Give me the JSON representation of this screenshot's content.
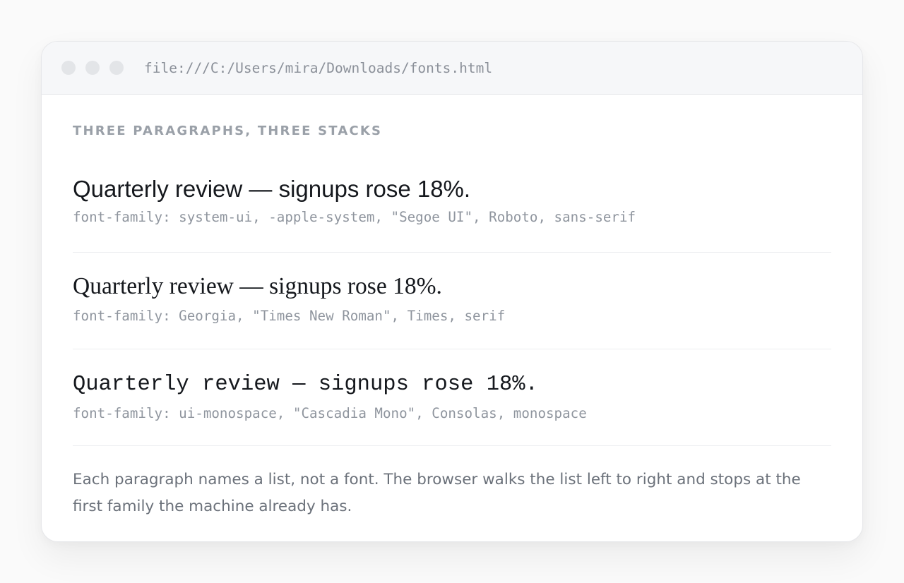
{
  "window": {
    "address": "file:///C:/Users/mira/Downloads/fonts.html",
    "controls": [
      "close-icon",
      "minimize-icon",
      "maximize-icon"
    ]
  },
  "page": {
    "heading": "THREE PARAGRAPHS, THREE STACKS",
    "samples": [
      {
        "text": "Quarterly review — signups rose 18%.",
        "stack": "font-family: system-ui, -apple-system, \"Segoe UI\", Roboto, sans-serif"
      },
      {
        "text": "Quarterly review — signups rose 18%.",
        "stack": "font-family: Georgia, \"Times New Roman\", Times, serif"
      },
      {
        "text": "Quarterly review — signups rose 18%.",
        "stack": "font-family: ui-monospace, \"Cascadia Mono\", Consolas, monospace"
      }
    ],
    "note": "Each paragraph names a list, not a font. The browser walks the list left to right and stops at the first family the machine already has."
  },
  "colors": {
    "page_background": "#fafafa",
    "window_background": "#ffffff",
    "titlebar": "#f6f7f9",
    "heading": "#9aa0a8",
    "sample_text": "#15181d",
    "stack_text": "#8f959e",
    "note_text": "#6b717a"
  }
}
